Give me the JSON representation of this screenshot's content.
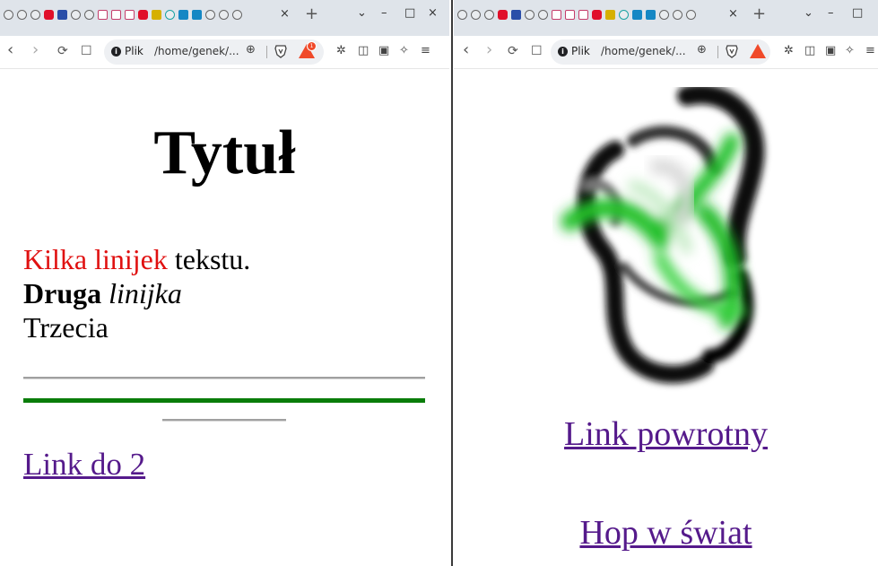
{
  "left_window": {
    "tab": {
      "close_icon": "×",
      "new_tab_icon": "+"
    },
    "window_controls": {
      "dropdown": "⌄",
      "minimize": "–",
      "maximize": "□",
      "close": "×"
    },
    "navbar": {
      "back": "‹",
      "forward": "›",
      "reload": "⟳",
      "bookmark": "☐",
      "site_info": "Plik",
      "url": "/home/genek/...",
      "zoom_icon": "⊕"
    },
    "page": {
      "title": "Tytuł",
      "line1_red": "Kilka linijek",
      "line1_rest": " tekstu.",
      "line2_bold": "Druga",
      "line2_italic": "linijka",
      "line3": "Trzecia",
      "link": "Link do 2",
      "hr_green_color": "#0a7d0a"
    }
  },
  "right_window": {
    "tab": {
      "close_icon": "×",
      "new_tab_icon": "+"
    },
    "window_controls": {
      "dropdown": "⌄",
      "minimize": "–",
      "maximize": "□"
    },
    "navbar": {
      "back": "‹",
      "forward": "›",
      "reload": "⟳",
      "bookmark": "☐",
      "site_info": "Plik",
      "url": "/home/genek/...",
      "zoom_icon": "⊕"
    },
    "page": {
      "image_alt": "abstract green and black swirl",
      "link_back": "Link powrotny",
      "link_hop": "Hop w świat"
    }
  },
  "colors": {
    "link": "#551a8b",
    "red_text": "#e01010",
    "tabbar_bg": "#dfe4ea",
    "accent_green": "#22c02a"
  }
}
